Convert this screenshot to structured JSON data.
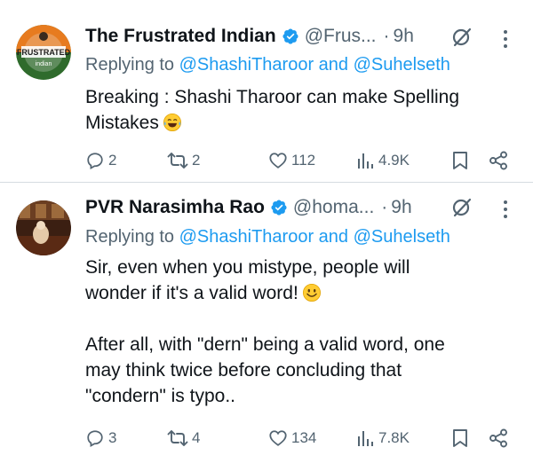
{
  "tweets": [
    {
      "name": "The Frustrated Indian",
      "handle": "@Frus...",
      "time": "9h",
      "reply_prefix": "Replying to",
      "reply_mention_1": "@ShashiTharoor",
      "reply_and": "and",
      "reply_mention_2": "@Suhelseth",
      "text_1": "Breaking : Shashi Tharoor can make Spelling",
      "text_2": "Mistakes",
      "emoji": "tears-of-joy-emoji",
      "avatar_text": "FRUSTRATED indian",
      "replies": "2",
      "reposts": "2",
      "likes": "112",
      "views": "4.9K"
    },
    {
      "name": "PVR Narasimha Rao",
      "handle": "@homa...",
      "time": "9h",
      "reply_prefix": "Replying to",
      "reply_mention_1": "@ShashiTharoor",
      "reply_and": "and",
      "reply_mention_2": "@Suhelseth",
      "text_1": "Sir, even when you mistype, people will",
      "text_2": "wonder if it's a valid word!",
      "text_3": "After all, with \"dern\" being a valid word, one",
      "text_4": "may think twice before concluding that",
      "text_5": "\"condern\" is typo..",
      "emoji": "smiling-face-emoji",
      "replies": "3",
      "reposts": "4",
      "likes": "134",
      "views": "7.8K"
    }
  ],
  "colors": {
    "text": "#0f1419",
    "secondary": "#536471",
    "accent": "#1d9bf0",
    "divider": "#d5dbe0"
  },
  "icons": [
    "verified-badge-icon",
    "grok-icon",
    "more-icon",
    "reply-icon",
    "repost-icon",
    "like-icon",
    "views-icon",
    "bookmark-icon",
    "share-icon"
  ]
}
